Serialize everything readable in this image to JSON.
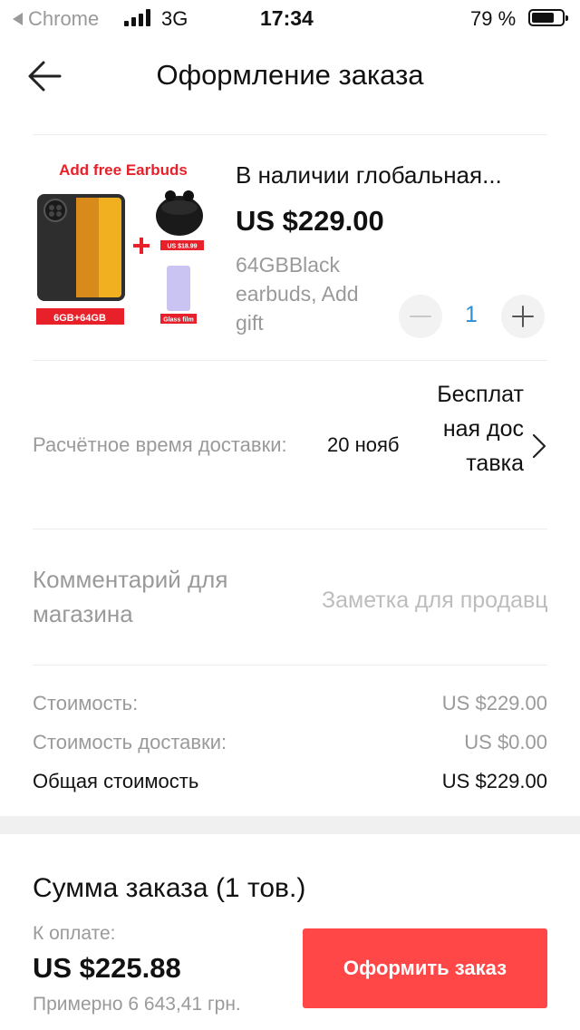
{
  "status_bar": {
    "back_app": "Chrome",
    "network": "3G",
    "time": "17:34",
    "battery_pct": "79 %",
    "battery_level": 0.79
  },
  "header": {
    "title": "Оформление заказа",
    "back_icon": "arrow-left-icon"
  },
  "product": {
    "image_text": {
      "promo": "Add free Earbuds",
      "storage_tag": "6GB+64GB",
      "earbuds_price": "US $18.99",
      "film_label": "Glass film"
    },
    "title": "В наличии глобальная...",
    "price": "US $229.00",
    "variant": "64GBBlack earbuds, Add gift",
    "quantity": "1"
  },
  "delivery": {
    "label": "Расчётное время доставки:",
    "date": "20  нояб",
    "shipping": "Бесплатная доставка"
  },
  "comment": {
    "label": "Комментарий для магазина",
    "placeholder": "Заметка для продавца"
  },
  "costs": {
    "subtotal_label": "Стоимость:",
    "subtotal_value": "US $229.00",
    "shipping_label": "Стоимость доставки:",
    "shipping_value": "US $0.00",
    "total_label": "Общая стоимость",
    "total_value": "US $229.00"
  },
  "footer": {
    "summary_title": "Сумма заказа (1 тов.)",
    "pay_label": "К оплате:",
    "pay_amount": "US $225.88",
    "pay_approx": "Примерно 6 643,41 грн.",
    "order_button": "Оформить заказ"
  },
  "colors": {
    "accent_red": "#ff4747",
    "quantity_blue": "#2d8fd6",
    "muted_text": "#9a9a9a"
  }
}
